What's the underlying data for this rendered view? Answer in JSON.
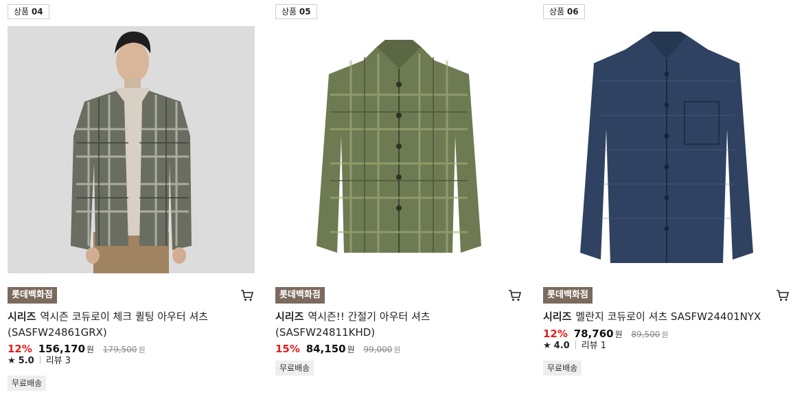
{
  "products": [
    {
      "tag_label": "상품",
      "tag_number": "04",
      "store": "롯데백화점",
      "brand": "시리즈",
      "name": "역시즌 코듀로이 체크 퀼팅 아우터 셔츠 (SASFW24861GRX)",
      "discount": "12%",
      "price": "156,170",
      "price_unit": "원",
      "original_price": "179,500",
      "original_unit": "원",
      "rating": "5.0",
      "review_label": "리뷰 3",
      "shipping": "무료배송",
      "image_icon": "jacket-model-image"
    },
    {
      "tag_label": "상품",
      "tag_number": "05",
      "store": "롯데백화점",
      "brand": "시리즈",
      "name": "역시즌!! 간절기 아우터 셔츠 (SASFW24811KHD)",
      "discount": "15%",
      "price": "84,150",
      "price_unit": "원",
      "original_price": "99,000",
      "original_unit": "원",
      "shipping": "무료배송",
      "image_icon": "shirt-jacket-image"
    },
    {
      "tag_label": "상품",
      "tag_number": "06",
      "store": "롯데백화점",
      "brand": "시리즈",
      "name": "멜란지 코듀로이 셔츠 SASFW24401NYX",
      "discount": "12%",
      "price": "78,760",
      "price_unit": "원",
      "original_price": "89,500",
      "original_unit": "원",
      "rating": "4.0",
      "review_label": "리뷰 1",
      "shipping": "무료배송",
      "image_icon": "navy-shirt-image"
    }
  ],
  "colors": {
    "discount": "#e0201b",
    "store_badge": "#7b6a5d",
    "shipping_bg": "#eeeeee"
  }
}
